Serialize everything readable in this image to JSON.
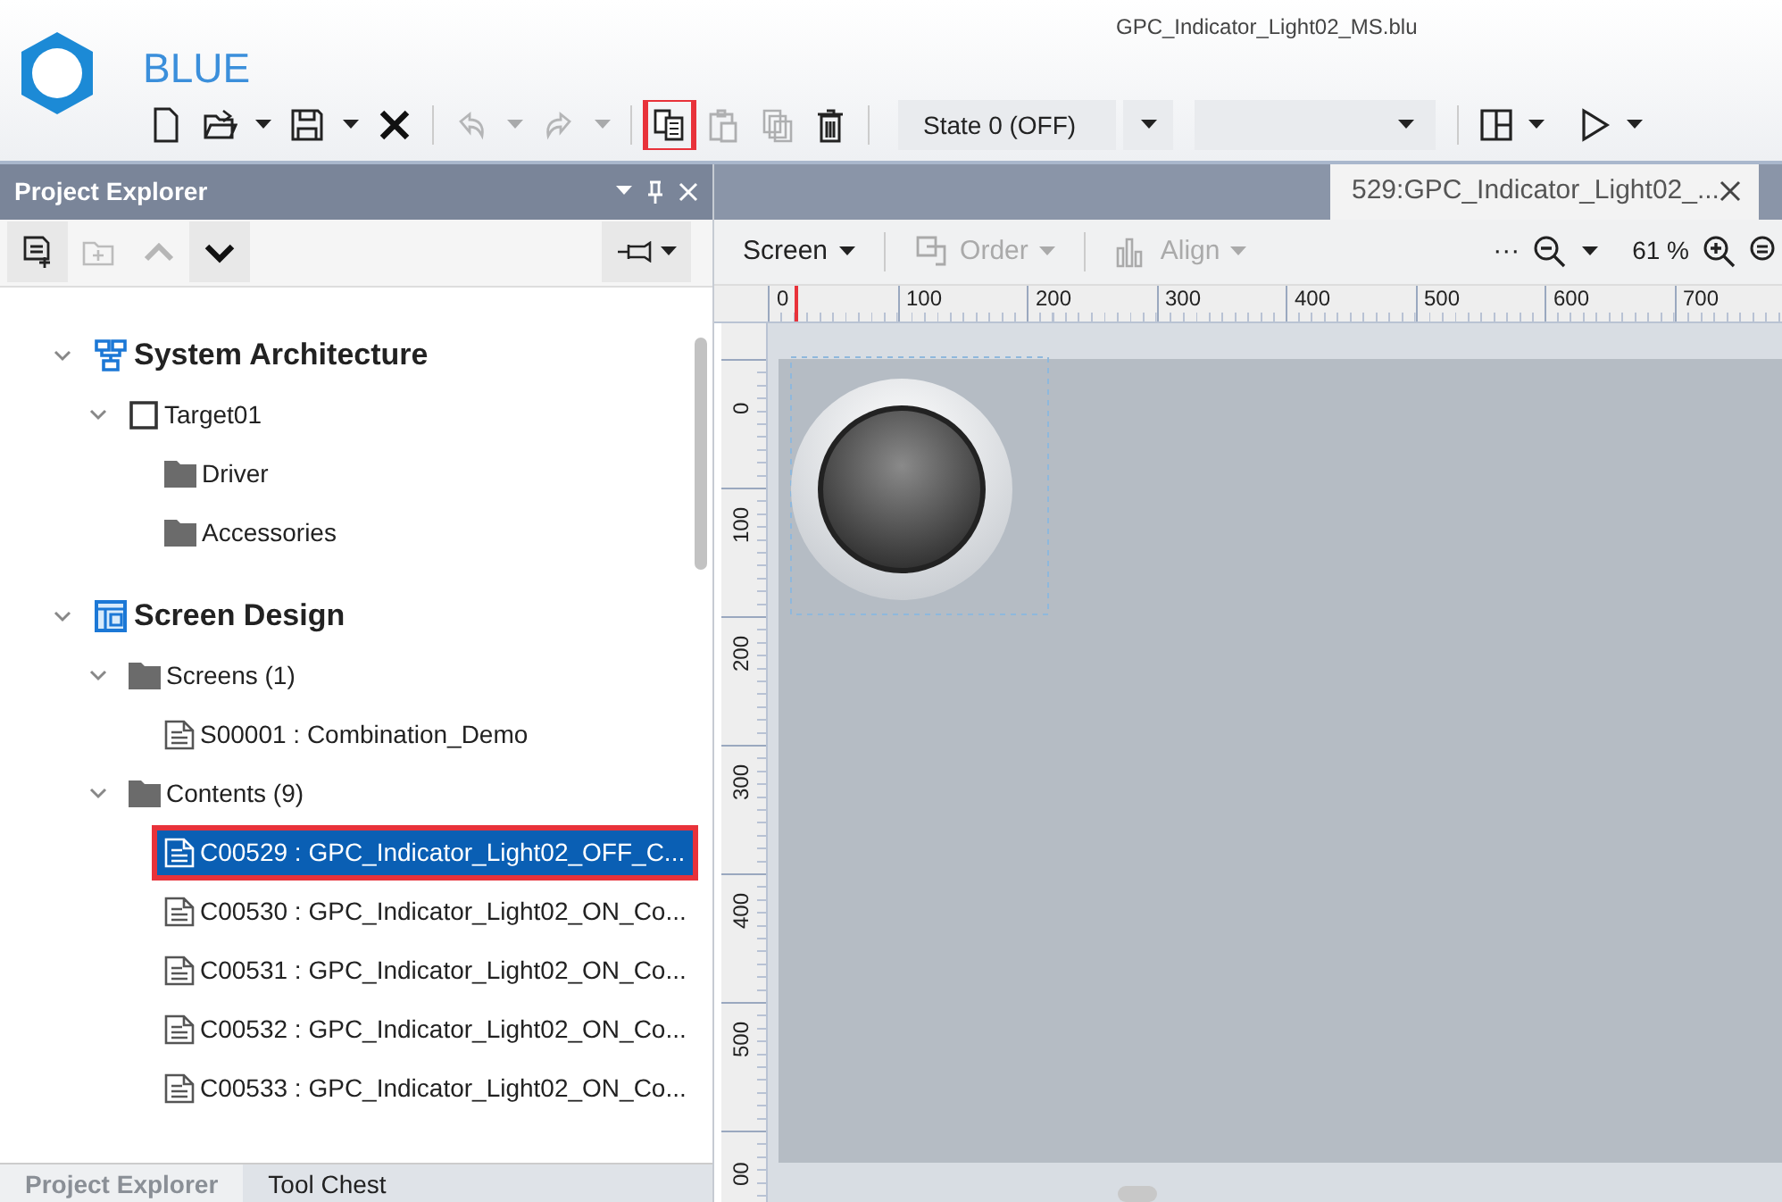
{
  "app": {
    "logo_text": "BLUE",
    "file_title": "GPC_Indicator_Light02_MS.blu"
  },
  "toolbar": [
    {
      "kind": "new",
      "disabled": false,
      "dropdown": false,
      "highlighted": false
    },
    {
      "kind": "open",
      "disabled": false,
      "dropdown": true,
      "highlighted": false
    },
    {
      "kind": "save",
      "disabled": false,
      "dropdown": true,
      "highlighted": false
    },
    {
      "kind": "close",
      "disabled": false,
      "dropdown": false,
      "highlighted": false
    },
    {
      "kind": "undo",
      "disabled": true,
      "dropdown": true,
      "highlighted": false
    },
    {
      "kind": "redo",
      "disabled": true,
      "dropdown": true,
      "highlighted": false
    },
    {
      "kind": "copy",
      "disabled": false,
      "dropdown": false,
      "highlighted": true
    },
    {
      "kind": "paste",
      "disabled": true,
      "dropdown": false,
      "highlighted": false
    },
    {
      "kind": "duplicate",
      "disabled": true,
      "dropdown": false,
      "highlighted": false
    },
    {
      "kind": "delete",
      "disabled": false,
      "dropdown": false,
      "highlighted": false
    }
  ],
  "state_select": {
    "value": "State 0 (OFF)"
  },
  "toolbar_right": [
    {
      "kind": "layout",
      "dropdown": true
    },
    {
      "kind": "play",
      "dropdown": true
    }
  ],
  "project_explorer": {
    "title": "Project Explorer",
    "toolbar": [
      {
        "kind": "add-item",
        "disabled": false
      },
      {
        "kind": "add-folder",
        "disabled": true
      },
      {
        "kind": "up",
        "disabled": true
      },
      {
        "kind": "down",
        "disabled": false
      }
    ],
    "tree": [
      {
        "label": "System Architecture",
        "kind": "architecture",
        "expanded": true,
        "selected": false,
        "highlighted": false,
        "children": [
          {
            "label": "Target01",
            "kind": "device",
            "expanded": true,
            "selected": false,
            "highlighted": false,
            "children": [
              {
                "label": "Driver",
                "kind": "folder",
                "selected": false,
                "highlighted": false
              },
              {
                "label": "Accessories",
                "kind": "folder",
                "selected": false,
                "highlighted": false
              }
            ]
          }
        ]
      },
      {
        "label": "Screen Design",
        "kind": "design",
        "expanded": true,
        "selected": false,
        "highlighted": false,
        "children": [
          {
            "label": "Screens (1)",
            "kind": "folder",
            "expanded": true,
            "selected": false,
            "highlighted": false,
            "children": [
              {
                "label": "S00001 : Combination_Demo",
                "kind": "page",
                "selected": false,
                "highlighted": false
              }
            ]
          },
          {
            "label": "Contents (9)",
            "kind": "folder",
            "expanded": true,
            "selected": false,
            "highlighted": false,
            "children": [
              {
                "label": "C00529 : GPC_Indicator_Light02_OFF_C...",
                "kind": "page",
                "selected": true,
                "highlighted": true
              },
              {
                "label": "C00530 : GPC_Indicator_Light02_ON_Co...",
                "kind": "page",
                "selected": false,
                "highlighted": false
              },
              {
                "label": "C00531 : GPC_Indicator_Light02_ON_Co...",
                "kind": "page",
                "selected": false,
                "highlighted": false
              },
              {
                "label": "C00532 : GPC_Indicator_Light02_ON_Co...",
                "kind": "page",
                "selected": false,
                "highlighted": false
              },
              {
                "label": "C00533 : GPC_Indicator_Light02_ON_Co...",
                "kind": "page",
                "selected": false,
                "highlighted": false
              }
            ]
          }
        ]
      }
    ],
    "bottom_tabs": [
      {
        "label": "Project Explorer",
        "selected": true
      },
      {
        "label": "Tool Chest",
        "selected": false
      }
    ]
  },
  "document_tabs": [
    {
      "label": "529:GPC_Indicator_Light02_...",
      "selected": true
    }
  ],
  "editor_toolbar": {
    "items": [
      {
        "label": "Screen",
        "kind": "dropdown",
        "disabled": false
      },
      {
        "label": "Order",
        "kind": "order",
        "disabled": true
      },
      {
        "label": "Align",
        "kind": "align",
        "disabled": true
      }
    ],
    "more": "···",
    "zoom": "61 %"
  },
  "rulers": {
    "horizontal": [
      "0",
      "100",
      "200",
      "300",
      "400",
      "500",
      "600",
      "700"
    ],
    "vertical": [
      "0",
      "100",
      "200",
      "300",
      "400",
      "500",
      "00"
    ]
  }
}
